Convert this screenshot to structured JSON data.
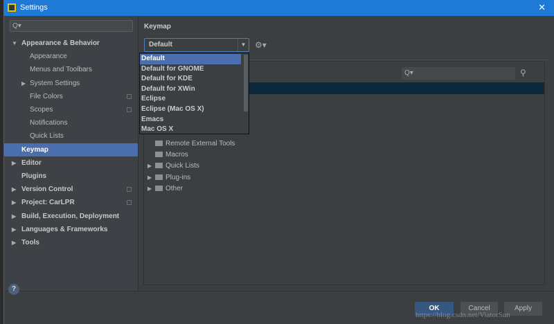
{
  "window": {
    "title": "Settings",
    "close": "✕"
  },
  "search": {
    "placeholder": "Q▾"
  },
  "sidebar": {
    "items": [
      {
        "label": "Appearance & Behavior",
        "bold": true,
        "arrow": "▼",
        "indent": 0
      },
      {
        "label": "Appearance",
        "indent": 1
      },
      {
        "label": "Menus and Toolbars",
        "indent": 1
      },
      {
        "label": "System Settings",
        "indent": 1,
        "arrow": "▶"
      },
      {
        "label": "File Colors",
        "indent": 1,
        "badge": true
      },
      {
        "label": "Scopes",
        "indent": 1,
        "badge": true
      },
      {
        "label": "Notifications",
        "indent": 1
      },
      {
        "label": "Quick Lists",
        "indent": 1
      },
      {
        "label": "Keymap",
        "bold": true,
        "selected": true,
        "indent": 0
      },
      {
        "label": "Editor",
        "bold": true,
        "arrow": "▶",
        "indent": 0
      },
      {
        "label": "Plugins",
        "bold": true,
        "indent": 0
      },
      {
        "label": "Version Control",
        "bold": true,
        "arrow": "▶",
        "indent": 0,
        "badge": true
      },
      {
        "label": "Project: CarLPR",
        "bold": true,
        "arrow": "▶",
        "indent": 0,
        "badge": true
      },
      {
        "label": "Build, Execution, Deployment",
        "bold": true,
        "arrow": "▶",
        "indent": 0
      },
      {
        "label": "Languages & Frameworks",
        "bold": true,
        "arrow": "▶",
        "indent": 0
      },
      {
        "label": "Tools",
        "bold": true,
        "arrow": "▶",
        "indent": 0
      }
    ]
  },
  "keymap": {
    "title": "Keymap",
    "selected": "Default",
    "options": [
      "Default",
      "Default for GNOME",
      "Default for KDE",
      "Default for XWin",
      "Eclipse",
      "Eclipse (Mac OS X)",
      "Emacs",
      "Mac OS X"
    ],
    "filter_placeholder": "Q▾"
  },
  "tree": [
    {
      "label": "Remote External Tools",
      "expandable": false
    },
    {
      "label": "Macros",
      "expandable": false
    },
    {
      "label": "Quick Lists",
      "expandable": true
    },
    {
      "label": "Plug-ins",
      "expandable": true
    },
    {
      "label": "Other",
      "expandable": true
    }
  ],
  "buttons": {
    "help": "?",
    "ok": "OK",
    "cancel": "Cancel",
    "apply": "Apply"
  },
  "watermark": "https://blog.csdn.net/ViatorSun",
  "colors": {
    "accent": "#4b6eaf",
    "titlebar": "#1f7ad6",
    "ok": "#365880"
  }
}
